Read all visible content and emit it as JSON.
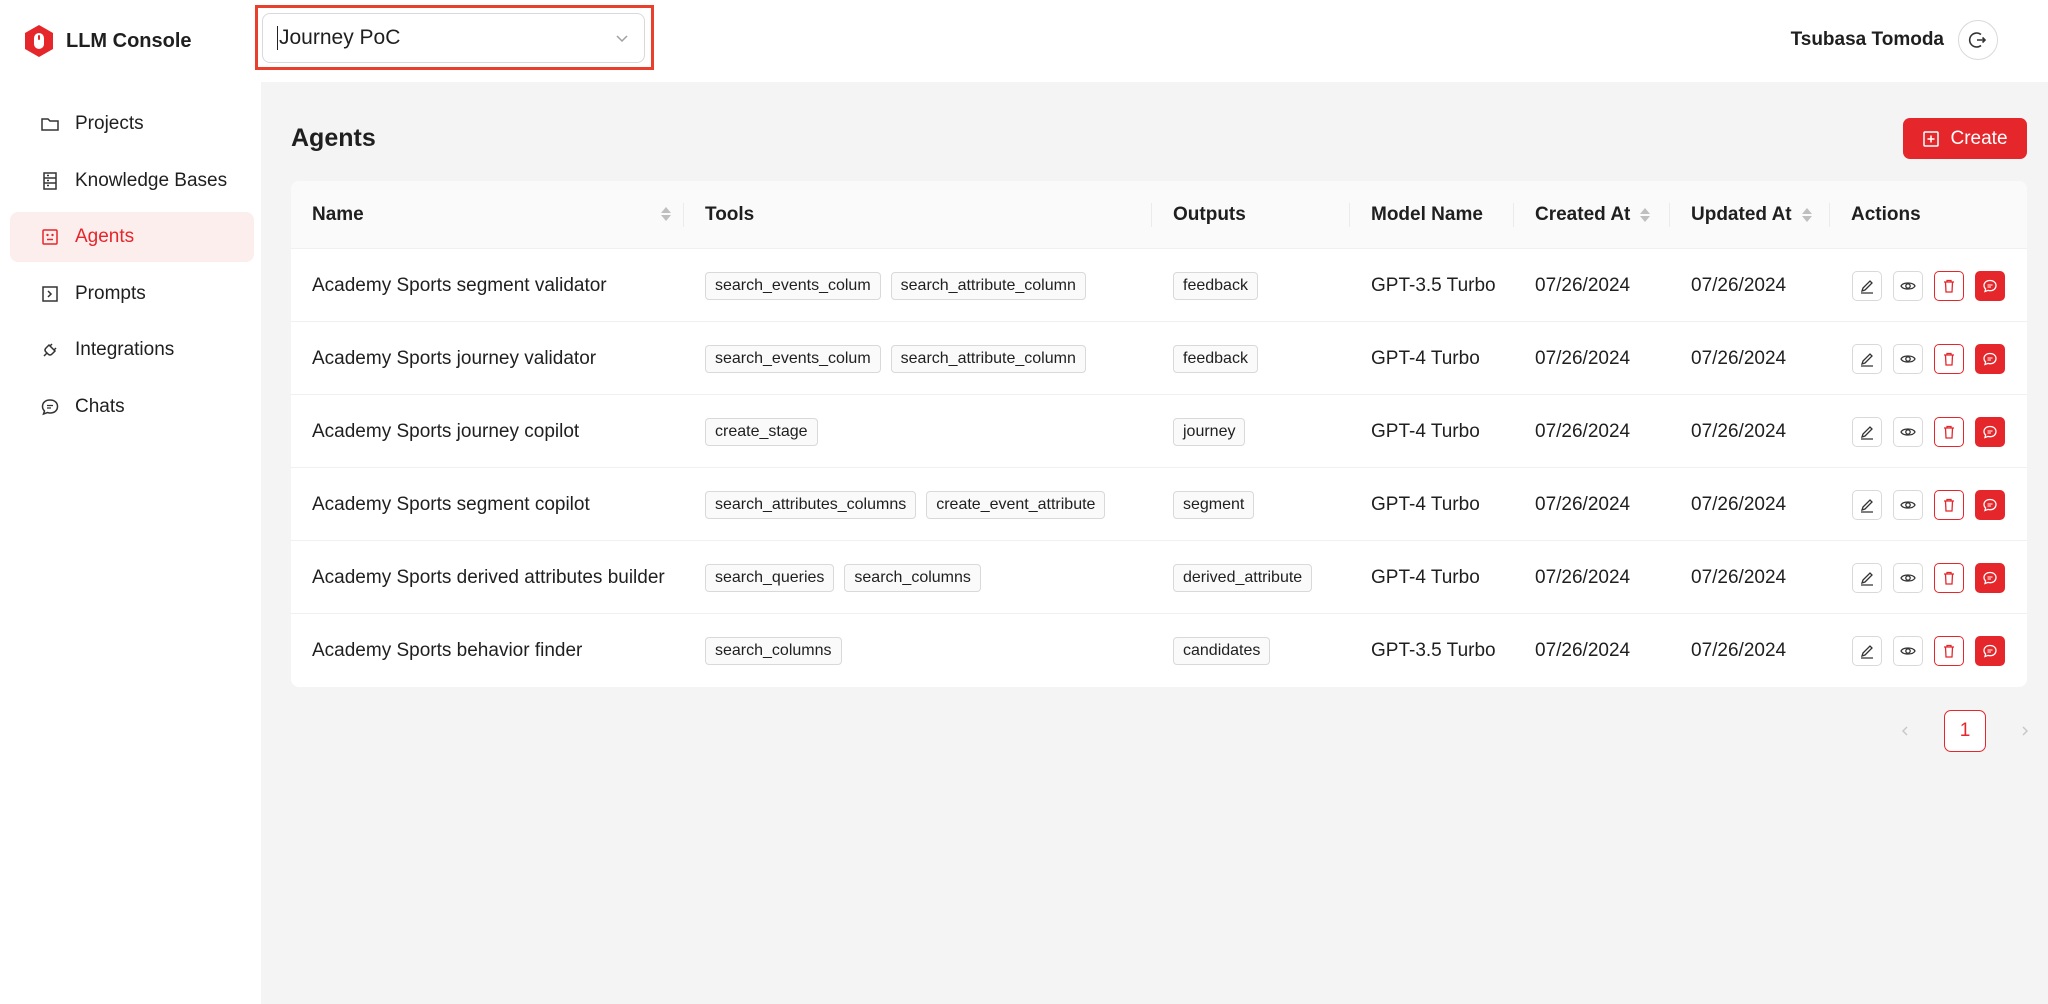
{
  "app": {
    "title": "LLM Console"
  },
  "project_select": {
    "value": "Journey PoC"
  },
  "user": {
    "name": "Tsubasa Tomoda"
  },
  "sidebar": {
    "items": [
      {
        "label": "Projects",
        "icon": "folder-icon",
        "active": false
      },
      {
        "label": "Knowledge Bases",
        "icon": "database-icon",
        "active": false
      },
      {
        "label": "Agents",
        "icon": "robot-icon",
        "active": true
      },
      {
        "label": "Prompts",
        "icon": "code-square-icon",
        "active": false
      },
      {
        "label": "Integrations",
        "icon": "plug-icon",
        "active": false
      },
      {
        "label": "Chats",
        "icon": "chat-icon",
        "active": false
      }
    ]
  },
  "main": {
    "title": "Agents",
    "create_label": "Create"
  },
  "table": {
    "columns": [
      "Name",
      "Tools",
      "Outputs",
      "Model Name",
      "Created At",
      "Updated At",
      "Actions"
    ],
    "rows": [
      {
        "name": "Academy Sports segment validator",
        "tools": [
          "search_events_colum",
          "search_attribute_column"
        ],
        "outputs": [
          "feedback"
        ],
        "model": "GPT-3.5 Turbo",
        "created": "07/26/2024",
        "updated": "07/26/2024"
      },
      {
        "name": "Academy Sports journey validator",
        "tools": [
          "search_events_colum",
          "search_attribute_column"
        ],
        "outputs": [
          "feedback"
        ],
        "model": "GPT-4 Turbo",
        "created": "07/26/2024",
        "updated": "07/26/2024"
      },
      {
        "name": "Academy Sports journey copilot",
        "tools": [
          "create_stage"
        ],
        "outputs": [
          "journey"
        ],
        "model": "GPT-4 Turbo",
        "created": "07/26/2024",
        "updated": "07/26/2024"
      },
      {
        "name": "Academy Sports segment copilot",
        "tools": [
          "search_attributes_columns",
          "create_event_attribute"
        ],
        "outputs": [
          "segment"
        ],
        "model": "GPT-4 Turbo",
        "created": "07/26/2024",
        "updated": "07/26/2024"
      },
      {
        "name": "Academy Sports derived attributes builder",
        "tools": [
          "search_queries",
          "search_columns"
        ],
        "outputs": [
          "derived_attribute"
        ],
        "model": "GPT-4 Turbo",
        "created": "07/26/2024",
        "updated": "07/26/2024"
      },
      {
        "name": "Academy Sports behavior finder",
        "tools": [
          "search_columns"
        ],
        "outputs": [
          "candidates"
        ],
        "model": "GPT-3.5 Turbo",
        "created": "07/26/2024",
        "updated": "07/26/2024"
      }
    ]
  },
  "pagination": {
    "current": "1"
  },
  "colors": {
    "accent": "#e5262b",
    "highlight_border": "#e8402c"
  }
}
